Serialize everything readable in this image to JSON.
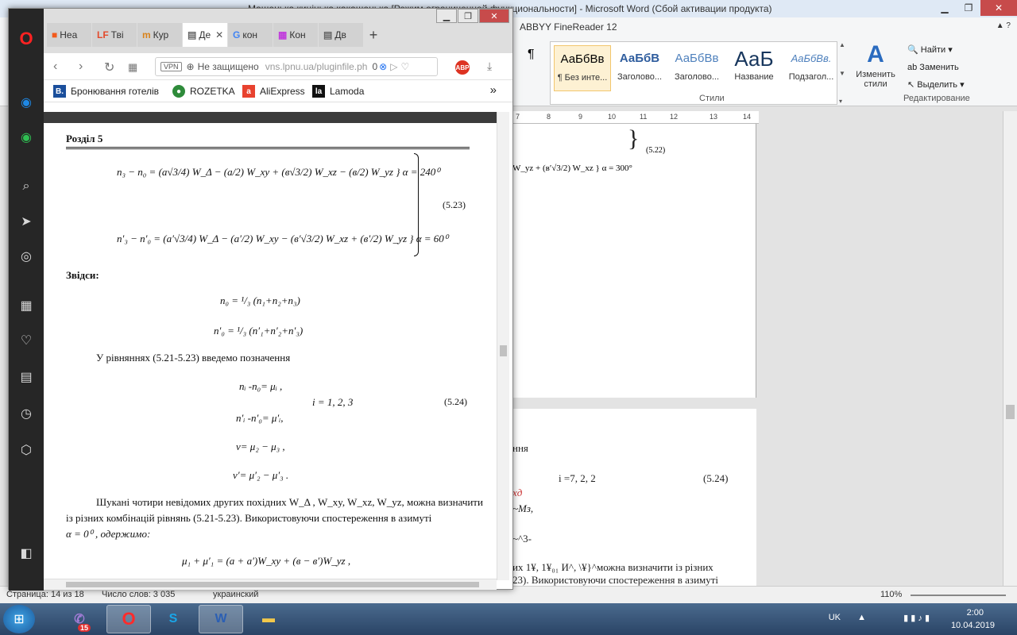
{
  "word": {
    "title": "Машенька кицінька какашенька [Режим ограниченной функциональности] - Microsoft Word (Сбой активации продукта)",
    "fr_tab": "ABBYY FineReader 12",
    "para_mark": "¶",
    "styles": [
      {
        "sample": "АаБбВв",
        "name": "¶ Без инте..."
      },
      {
        "sample": "АаБбВ",
        "name": "Заголово..."
      },
      {
        "sample": "АаБбВв",
        "name": "Заголово..."
      },
      {
        "sample": "АаБ",
        "name": "Название"
      },
      {
        "sample": "АаБбВв.",
        "name": "Подзагол..."
      }
    ],
    "change_styles": "Изменить стили",
    "group_styles": "Стили",
    "editing": {
      "find": "Найти",
      "replace": "Заменить",
      "select": "Выделить",
      "label": "Редактирование"
    },
    "ruler": [
      "7",
      "8",
      "9",
      "10",
      "11",
      "12",
      "13",
      "14"
    ],
    "page1_eq_label": "(5.22)",
    "page1_formula": "W_yz + (в′√3/2) W_xz } α = 300°",
    "page2": {
      "fragment1": "ння",
      "i_eq": "i =7, 2, 2",
      "eq_num": "(5.24)",
      "fragment2": "хд",
      "fragment3": "~Мз,",
      "fragment4": "~^3-",
      "line1": "их 1¥, 1¥₀₁ И^, \\¥}^можна визначити із різних",
      "line2": "23). Використовуючи спостереження в азимуті"
    },
    "status": {
      "page": "Страница: 14 из 18",
      "words": "Число слов: 3 035",
      "lang": "украинский",
      "zoom": "110%"
    }
  },
  "browser": {
    "tabs": [
      {
        "icon": "■",
        "label": "Неа"
      },
      {
        "icon": "LF",
        "label": "Тві"
      },
      {
        "icon": "m",
        "label": "Кур"
      },
      {
        "icon": "▤",
        "label": "Де"
      },
      {
        "icon": "G",
        "label": "кон"
      },
      {
        "icon": "▦",
        "label": "Кон"
      },
      {
        "icon": "▤",
        "label": "Дв"
      }
    ],
    "url": {
      "vpn": "VPN",
      "security": "Не защищено",
      "address": "vns.lpnu.ua/pluginfile.ph",
      "badge": "0"
    },
    "adblock": "ABP",
    "bookmarks": [
      {
        "icon": "B.",
        "label": "Бронювання готелів",
        "color": "#1b4f9c"
      },
      {
        "icon": "●",
        "label": "ROZETKA",
        "color": "#2e8b3a"
      },
      {
        "icon": "a",
        "label": "AliExpress",
        "color": "#e8422f"
      },
      {
        "icon": "la",
        "label": "Lamoda",
        "color": "#111111"
      }
    ],
    "more": "»"
  },
  "doc": {
    "section": "Розділ 5",
    "eq1": "n₃ − n₀ = (a√3/4) W_Δ − (a/2) W_xy + (в√3/2) W_xz − (в/2) W_yz }   α = 240⁰",
    "eq523": "(5.23)",
    "eq2": "n′₃ − n′₀ = (a′√3/4) W_Δ − (a′/2) W_xy − (в′√3/2) W_xz + (в′/2) W_yz }   α = 60⁰",
    "zvidsy": "Звідси:",
    "n0": "n₀ = ¹/₃ (n₁+n₂+n₃)",
    "n0p": "n′₀ = ¹/₃ (n′₁+n′₂+n′₃)",
    "intro": "У рівняннях (5.21-5.23) введемо позначення",
    "mu": "nᵢ -n₀= μᵢ ,",
    "i_range": "i = 1, 2, 3",
    "eq524": "(5.24)",
    "mup": "n′ᵢ -n′₀= μ′ᵢ,",
    "nu": "ν= μ₂ − μ₃ ,",
    "nup": "ν′= μ′₂ − μ′₃ .",
    "para1": "Шукані чотири невідомих других похідних W_Δ , W_xy, W_xz, W_yz, можна визначити",
    "para2": "із різних комбінацій рівнянь (5.21-5.23). Використовуючи спостереження в азимуті",
    "para3": "α = 0⁰ , одержимо:",
    "eqlast": "μ₁ + μ′₁ = (a + a′)W_xy + (в − в′)W_yz ,"
  },
  "taskbar": {
    "viber_badge": "15",
    "tray": {
      "lang": "UK",
      "time": "2:00",
      "date": "10.04.2019"
    }
  }
}
